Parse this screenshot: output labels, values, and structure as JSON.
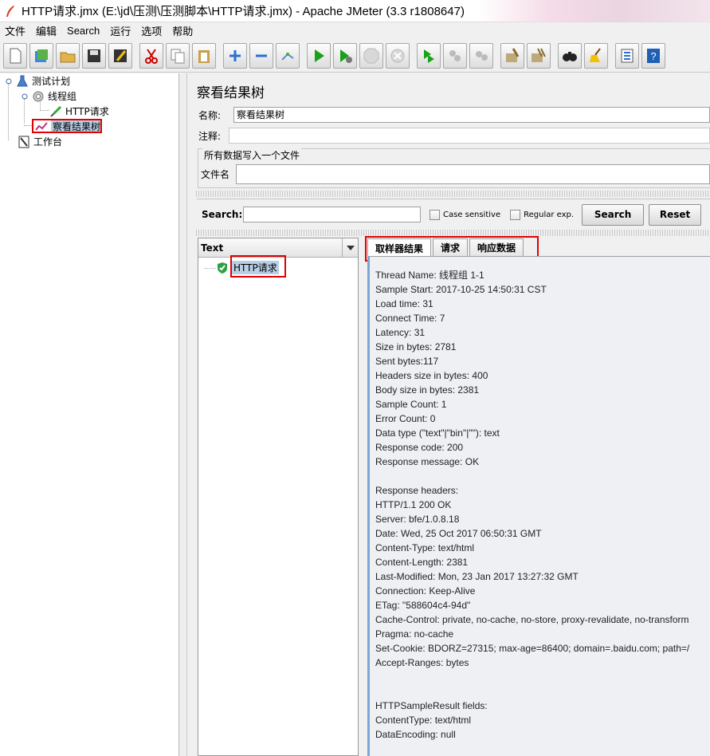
{
  "window": {
    "title": "HTTP请求.jmx (E:\\jd\\压测\\压测脚本\\HTTP请求.jmx) - Apache JMeter (3.3 r1808647)"
  },
  "menu": [
    "文件",
    "编辑",
    "Search",
    "运行",
    "选项",
    "帮助"
  ],
  "toolbar": {
    "icons": [
      "new-icon",
      "templates-icon",
      "open-icon",
      "save-icon",
      "save-as-icon",
      "cut-icon",
      "copy-icon",
      "paste-icon",
      "expand-icon",
      "collapse-icon",
      "toggle-icon",
      "start-icon",
      "start-no-pause-icon",
      "stop-icon",
      "shutdown-icon",
      "remote-start-icon",
      "remote-stop-icon",
      "remote-shutdown-icon",
      "clear-icon",
      "clear-all-icon",
      "search-binoculars-icon",
      "reset-search-broom-icon",
      "function-helper-icon",
      "help-icon"
    ]
  },
  "tree": {
    "test_plan": "测试计划",
    "thread_group": "线程组",
    "http_request": "HTTP请求",
    "view_results_tree": "察看结果树",
    "workbench": "工作台"
  },
  "panel": {
    "title": "察看结果树",
    "name_label": "名称:",
    "name_value": "察看结果树",
    "comment_label": "注释:",
    "comment_value": "",
    "file_group_title": "所有数据写入一个文件",
    "filename_label": "文件名",
    "filename_value": ""
  },
  "search": {
    "label": "Search:",
    "value": "",
    "case_sensitive": "Case sensitive",
    "regular_exp": "Regular exp.",
    "search_button": "Search",
    "reset_button": "Reset"
  },
  "results": {
    "renderer": "Text",
    "items": [
      "HTTP请求"
    ]
  },
  "tabs": [
    "取样器结果",
    "请求",
    "响应数据"
  ],
  "sampler_result": [
    "Thread Name: 线程组 1-1",
    "Sample Start: 2017-10-25 14:50:31 CST",
    "Load time: 31",
    "Connect Time: 7",
    "Latency: 31",
    "Size in bytes: 2781",
    "Sent bytes:117",
    "Headers size in bytes: 400",
    "Body size in bytes: 2381",
    "Sample Count: 1",
    "Error Count: 0",
    "Data type (\"text\"|\"bin\"|\"\"): text",
    "Response code: 200",
    "Response message: OK",
    "",
    "Response headers:",
    "HTTP/1.1 200 OK",
    "Server: bfe/1.0.8.18",
    "Date: Wed, 25 Oct 2017 06:50:31 GMT",
    "Content-Type: text/html",
    "Content-Length: 2381",
    "Last-Modified: Mon, 23 Jan 2017 13:27:32 GMT",
    "Connection: Keep-Alive",
    "ETag: \"588604c4-94d\"",
    "Cache-Control: private, no-cache, no-store, proxy-revalidate, no-transform",
    "Pragma: no-cache",
    "Set-Cookie: BDORZ=27315; max-age=86400; domain=.baidu.com; path=/",
    "Accept-Ranges: bytes",
    "",
    "",
    "HTTPSampleResult fields:",
    "ContentType: text/html",
    "DataEncoding: null"
  ],
  "colors": {
    "highlight_border": "#e00000",
    "selection_bg": "#b8cfe5",
    "detail_accent": "#7aa7d6"
  }
}
